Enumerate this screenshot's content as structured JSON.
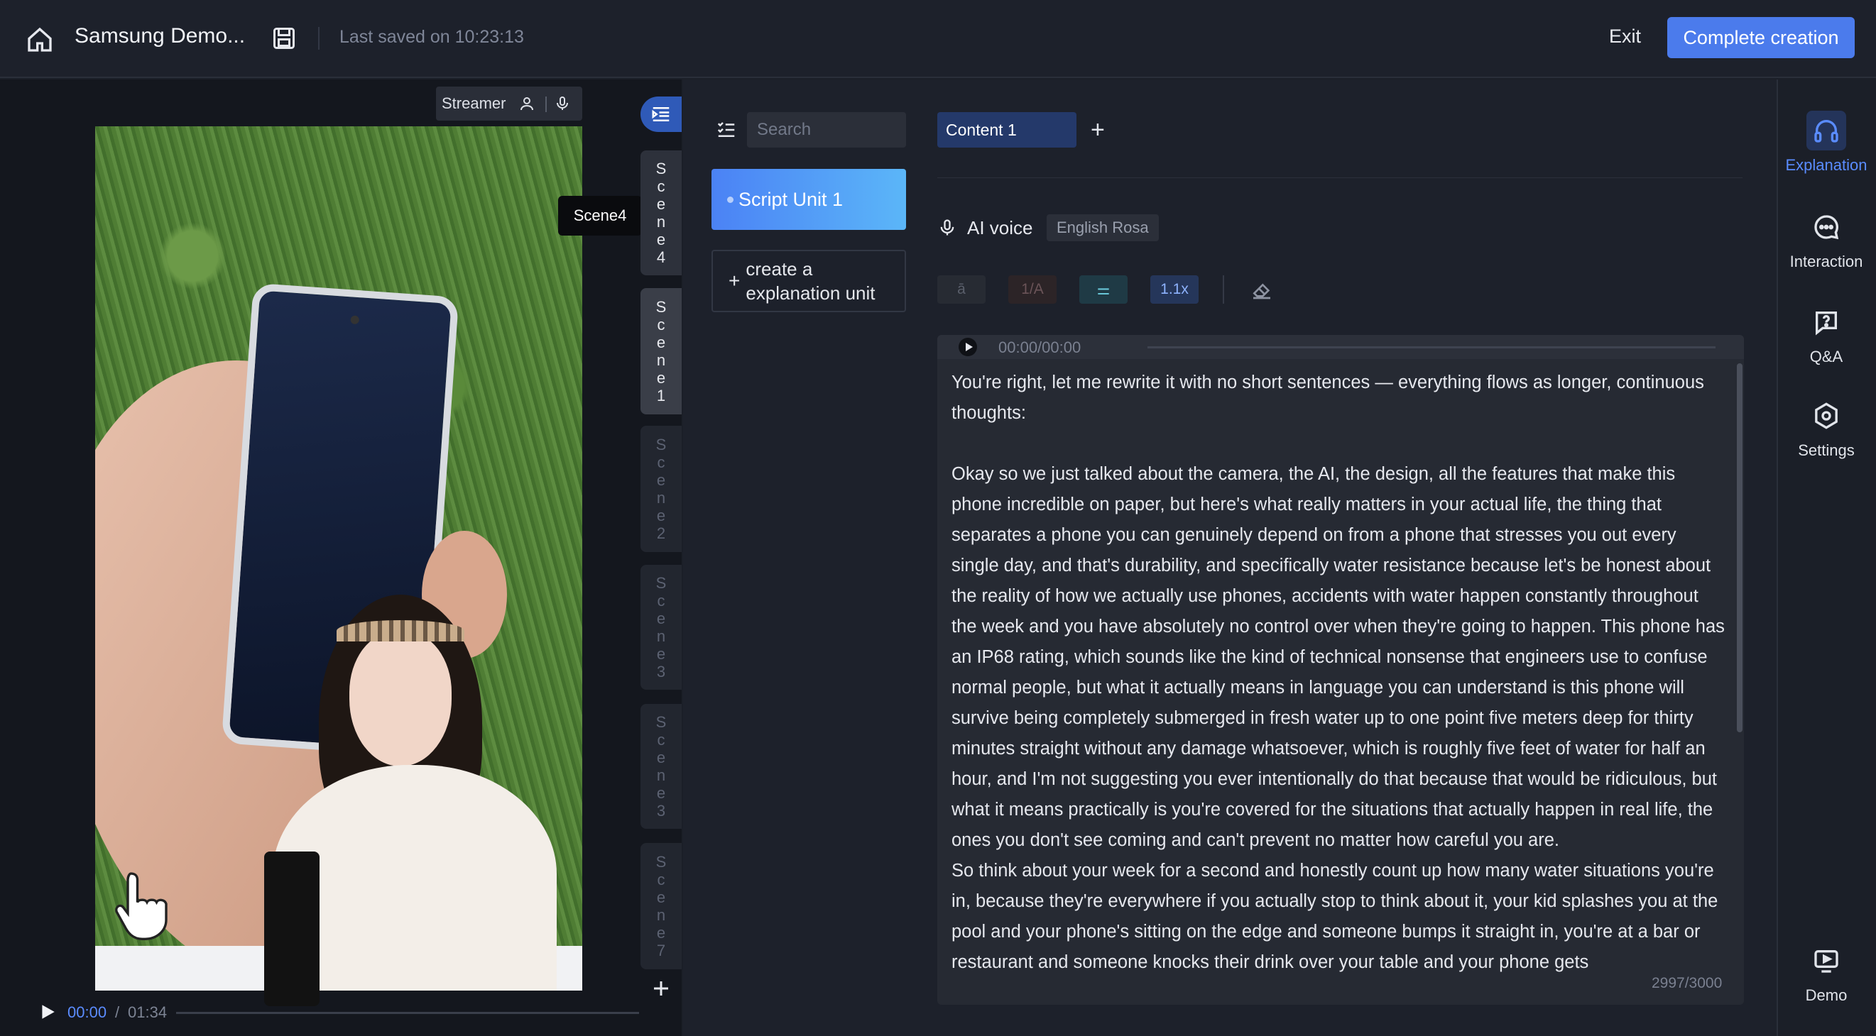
{
  "header": {
    "title": "Samsung Demo...",
    "last_saved": "Last saved on 10:23:13",
    "exit_label": "Exit",
    "complete_label": "Complete creation"
  },
  "preview": {
    "streamer_label": "Streamer",
    "tooltip": "Scene4",
    "time_current": "00:00",
    "time_separator": "/",
    "time_total": "01:34"
  },
  "scenes": [
    {
      "letters": [
        "S",
        "c",
        "e",
        "n",
        "e",
        "4"
      ],
      "state": "active"
    },
    {
      "letters": [
        "S",
        "c",
        "e",
        "n",
        "e",
        "1"
      ],
      "state": "active2"
    },
    {
      "letters": [
        "S",
        "c",
        "e",
        "n",
        "e",
        "2"
      ],
      "state": "inactive"
    },
    {
      "letters": [
        "S",
        "c",
        "e",
        "n",
        "e",
        "3"
      ],
      "state": "inactive"
    },
    {
      "letters": [
        "S",
        "c",
        "e",
        "n",
        "e",
        "3"
      ],
      "state": "inactive"
    },
    {
      "letters": [
        "S",
        "c",
        "e",
        "n",
        "e",
        "7"
      ],
      "state": "inactive"
    }
  ],
  "units": {
    "search_placeholder": "Search",
    "active_unit": "Script Unit 1",
    "create_label_line1": "create a",
    "create_label_line2": "explanation unit"
  },
  "content": {
    "tab_label": "Content 1",
    "voice_label": "AI voice",
    "voice_name": "English Rosa",
    "tools": [
      "ā",
      "1/A",
      "⚌",
      "1.1x"
    ],
    "audio_time": "00:00/00:00",
    "script_text": "You're right, let me rewrite it with no short sentences — everything flows as longer, continuous thoughts:\n\nOkay so we just talked about the camera, the AI, the design, all the features that make this phone incredible on paper, but here's what really matters in your actual life, the thing that separates a phone you can genuinely depend on from a phone that stresses you out every single day, and that's durability, and specifically water resistance because let's be honest about the reality of how we actually use phones, accidents with water happen constantly throughout the week and you have absolutely no control over when they're going to happen. This phone has an IP68 rating, which sounds like the kind of technical nonsense that engineers use to confuse normal people, but what it actually means in language you can understand is this phone will survive being completely submerged in fresh water up to one point five meters deep for thirty minutes straight without any damage whatsoever, which is roughly five feet of water for half an hour, and I'm not suggesting you ever intentionally do that because that would be ridiculous, but what it means practically is you're covered for the situations that actually happen in real life, the ones you don't see coming and can't prevent no matter how careful you are.\nSo think about your week for a second and honestly count up how many water situations you're in, because they're everywhere if you actually stop to think about it, your kid splashes you at the pool and your phone's sitting on the edge and someone bumps it straight in, you're at a bar or restaurant and someone knocks their drink over your table and your phone gets",
    "char_count": "2997/3000"
  },
  "sidebar": {
    "items": [
      {
        "label": "Explanation",
        "icon": "headphones-icon"
      },
      {
        "label": "Interaction",
        "icon": "chat-icon"
      },
      {
        "label": "Q&A",
        "icon": "question-icon"
      },
      {
        "label": "Settings",
        "icon": "settings-icon"
      },
      {
        "label": "Demo",
        "icon": "demo-icon"
      }
    ]
  }
}
